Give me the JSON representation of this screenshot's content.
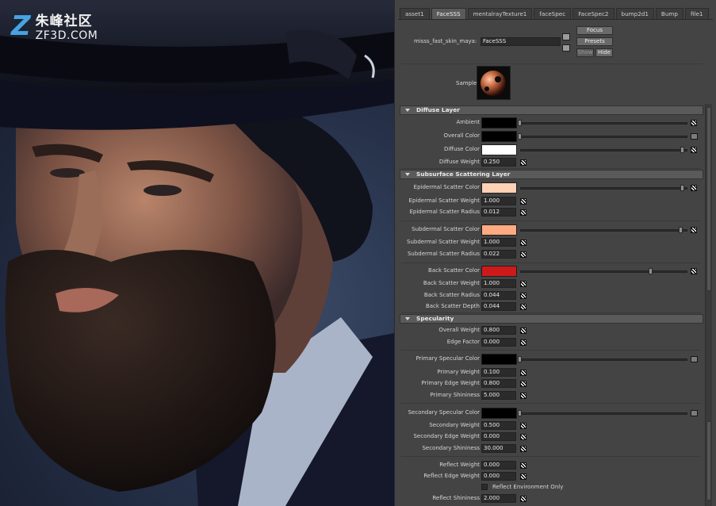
{
  "logo": {
    "cn": "朱峰社区",
    "en": "ZF3D.COM"
  },
  "tabs": [
    "asset1",
    "FaceSSS",
    "mentalrayTexture1",
    "faceSpec",
    "FaceSpec2",
    "bump2d1",
    "Bump",
    "file1"
  ],
  "active_tab": "FaceSSS",
  "node": {
    "label": "misss_fast_skin_maya:",
    "value": "FaceSSS"
  },
  "buttons": {
    "focus": "Focus",
    "presets": "Presets",
    "show": "Show",
    "hide": "Hide"
  },
  "sample_label": "Sample",
  "sections": {
    "diffuse": "Diffuse Layer",
    "sss": "Subsurface Scattering Layer",
    "spec": "Specularity"
  },
  "diffuse": {
    "ambient": {
      "label": "Ambient",
      "color": "#000000"
    },
    "overall_color": {
      "label": "Overall Color",
      "color": "#000000"
    },
    "diffuse_color": {
      "label": "Diffuse Color",
      "color": "#ffffff"
    },
    "diffuse_weight": {
      "label": "Diffuse Weight",
      "value": "0.250"
    }
  },
  "epidermal": {
    "color": {
      "label": "Epidermal Scatter Color",
      "color": "#ffd1b5"
    },
    "weight": {
      "label": "Epidermal Scatter Weight",
      "value": "1.000"
    },
    "radius": {
      "label": "Epidermal Scatter Radius",
      "value": "0.012"
    }
  },
  "subdermal": {
    "color": {
      "label": "Subdermal Scatter Color",
      "color": "#ffaa80"
    },
    "weight": {
      "label": "Subdermal Scatter Weight",
      "value": "1.000"
    },
    "radius": {
      "label": "Subdermal Scatter Radius",
      "value": "0.022"
    }
  },
  "back": {
    "color": {
      "label": "Back Scatter Color",
      "color": "#cc1a1a"
    },
    "weight": {
      "label": "Back Scatter Weight",
      "value": "1.000"
    },
    "radius": {
      "label": "Back Scatter Radius",
      "value": "0.044"
    },
    "depth": {
      "label": "Back Scatter Depth",
      "value": "0.044"
    }
  },
  "spec": {
    "overall_weight": {
      "label": "Overall Weight",
      "value": "0.800"
    },
    "edge_factor": {
      "label": "Edge Factor",
      "value": "0.000"
    },
    "primary_color": {
      "label": "Primary Specular Color",
      "color": "#000000"
    },
    "primary_weight": {
      "label": "Primary Weight",
      "value": "0.100"
    },
    "primary_edge_weight": {
      "label": "Primary Edge Weight",
      "value": "0.800"
    },
    "primary_shininess": {
      "label": "Primary Shininess",
      "value": "5.000"
    },
    "secondary_color": {
      "label": "Secondary Specular Color",
      "color": "#000000"
    },
    "secondary_weight": {
      "label": "Secondary Weight",
      "value": "0.500"
    },
    "secondary_edge_weight": {
      "label": "Secondary Edge Weight",
      "value": "0.000"
    },
    "secondary_shininess": {
      "label": "Secondary Shininess",
      "value": "30.000"
    },
    "reflect_weight": {
      "label": "Reflect Weight",
      "value": "0.000"
    },
    "reflect_edge_weight": {
      "label": "Reflect Edge Weight",
      "value": "0.000"
    },
    "reflect_env_only": {
      "label": "Reflect Environment Only",
      "checked": false
    },
    "reflect_shininess": {
      "label": "Reflect Shininess",
      "value": "2.000"
    }
  }
}
